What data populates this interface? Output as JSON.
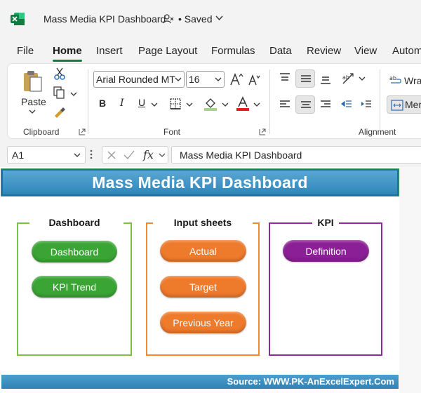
{
  "app": {
    "title": "Mass Media KPI Dashboard",
    "save_status": "• Saved"
  },
  "tabs": [
    "File",
    "Home",
    "Insert",
    "Page Layout",
    "Formulas",
    "Data",
    "Review",
    "View",
    "Autom"
  ],
  "active_tab": "Home",
  "ribbon": {
    "clipboard": {
      "label": "Clipboard",
      "paste_label": "Paste"
    },
    "font": {
      "label": "Font",
      "font_name": "Arial Rounded MT",
      "font_size": "16"
    },
    "alignment": {
      "label": "Alignment",
      "wrap_label": "Wra",
      "merge_label": "Mer"
    }
  },
  "formula_bar": {
    "name_box": "A1",
    "formula": "Mass Media KPI Dashboard"
  },
  "sheet": {
    "banner_title": "Mass Media KPI Dashboard",
    "panels": [
      {
        "title": "Dashboard",
        "color": "#7dc142",
        "buttons": [
          "Dashboard",
          "KPI Trend"
        ]
      },
      {
        "title": "Input sheets",
        "color": "#f08a32",
        "buttons": [
          "Actual",
          "Target",
          "Previous Year"
        ]
      },
      {
        "title": "KPI",
        "color": "#8e2a9c",
        "buttons": [
          "Definition"
        ]
      }
    ],
    "footer": "Source: WWW.PK-AnExcelExpert.Com"
  },
  "colors": {
    "excel_green": "#107c41",
    "banner_blue": "#3a8fc4",
    "green_button": "#3aa535",
    "orange_button": "#ee7a2c",
    "purple_button": "#8b1f95"
  }
}
